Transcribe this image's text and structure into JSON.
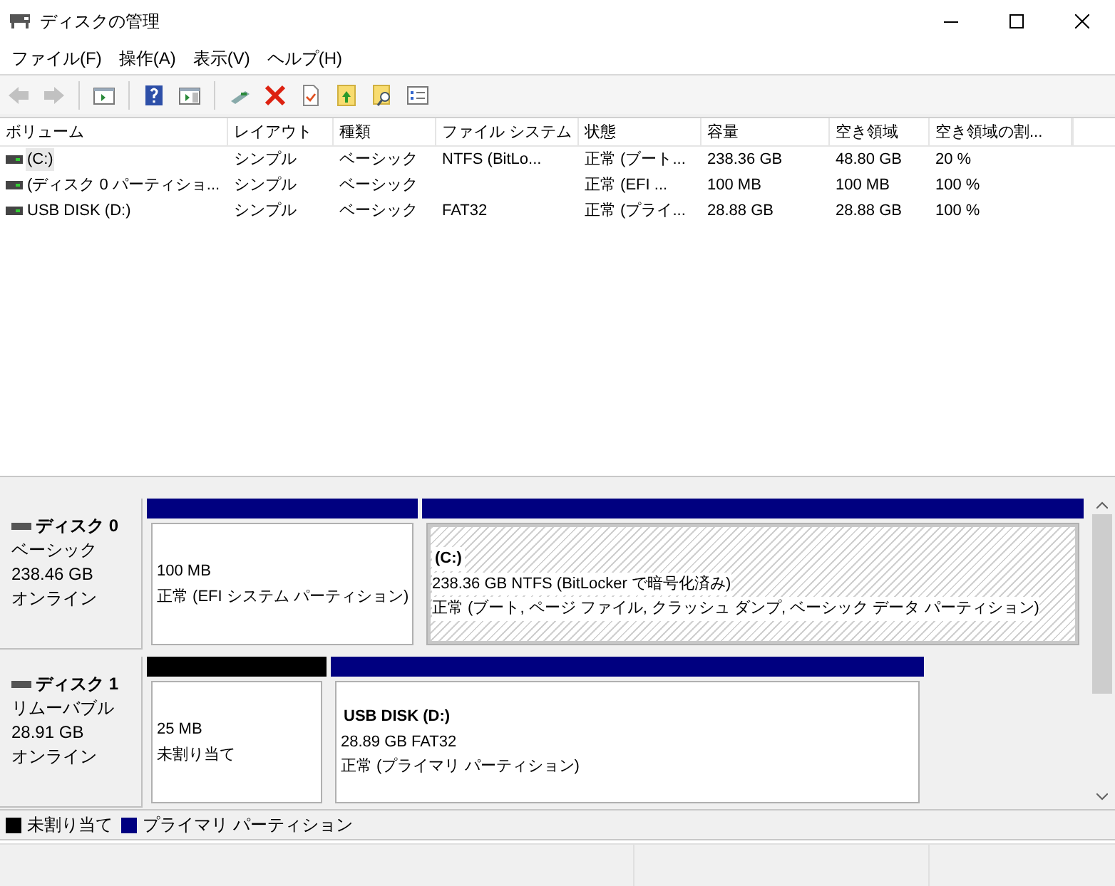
{
  "window": {
    "title": "ディスクの管理"
  },
  "menu": [
    "ファイル(F)",
    "操作(A)",
    "表示(V)",
    "ヘルプ(H)"
  ],
  "toolbar": [
    {
      "kind": "back",
      "disabled": true
    },
    {
      "kind": "forward",
      "disabled": true
    },
    {
      "kind": "sep"
    },
    {
      "kind": "tree",
      "disabled": false
    },
    {
      "kind": "sep"
    },
    {
      "kind": "help",
      "disabled": false
    },
    {
      "kind": "pane",
      "disabled": false
    },
    {
      "kind": "sep"
    },
    {
      "kind": "connect",
      "disabled": false
    },
    {
      "kind": "delete",
      "disabled": false
    },
    {
      "kind": "check",
      "disabled": false
    },
    {
      "kind": "folderup",
      "disabled": false
    },
    {
      "kind": "foldersearch",
      "disabled": false
    },
    {
      "kind": "props",
      "disabled": false
    }
  ],
  "table": {
    "columns": [
      "ボリューム",
      "レイアウト",
      "種類",
      "ファイル システム",
      "状態",
      "容量",
      "空き領域",
      "空き領域の割..."
    ],
    "rows": [
      {
        "selected": false,
        "focused": true,
        "cells": [
          "(C:)",
          "シンプル",
          "ベーシック",
          "NTFS (BitLo...",
          "正常 (ブート...",
          "238.36 GB",
          "48.80 GB",
          "20 %"
        ]
      },
      {
        "selected": false,
        "focused": false,
        "cells": [
          "(ディスク 0 パーティショ...",
          "シンプル",
          "ベーシック",
          "",
          "正常 (EFI ...",
          "100 MB",
          "100 MB",
          "100 %"
        ]
      },
      {
        "selected": false,
        "focused": false,
        "cells": [
          "USB DISK (D:)",
          "シンプル",
          "ベーシック",
          "FAT32",
          "正常 (プライ...",
          "28.88 GB",
          "28.88 GB",
          "100 %"
        ]
      }
    ]
  },
  "disks": [
    {
      "name": "ディスク 0",
      "type": "ベーシック",
      "size": "238.46 GB",
      "status": "オンライン",
      "partitions": [
        {
          "color": "#000080",
          "selected": false,
          "lines": [
            "100 MB",
            "正常 (EFI システム パーティション)"
          ]
        },
        {
          "color": "#000080",
          "selected": true,
          "name": "(C:)",
          "lines": [
            "238.36 GB NTFS (BitLocker で暗号化済み)",
            "正常 (ブート, ページ ファイル, クラッシュ ダンプ, ベーシック データ パーティション)"
          ]
        }
      ]
    },
    {
      "name": "ディスク 1",
      "type": "リムーバブル",
      "size": "28.91 GB",
      "status": "オンライン",
      "partitions": [
        {
          "color": "#000000",
          "selected": false,
          "lines": [
            "25 MB",
            "未割り当て"
          ]
        },
        {
          "color": "#000080",
          "selected": false,
          "name": "USB DISK  (D:)",
          "lines": [
            "28.89 GB FAT32",
            "正常 (プライマリ パーティション)"
          ]
        }
      ]
    }
  ],
  "legend": [
    {
      "color": "#000000",
      "label": "未割り当て"
    },
    {
      "color": "#000080",
      "label": "プライマリ パーティション"
    }
  ]
}
